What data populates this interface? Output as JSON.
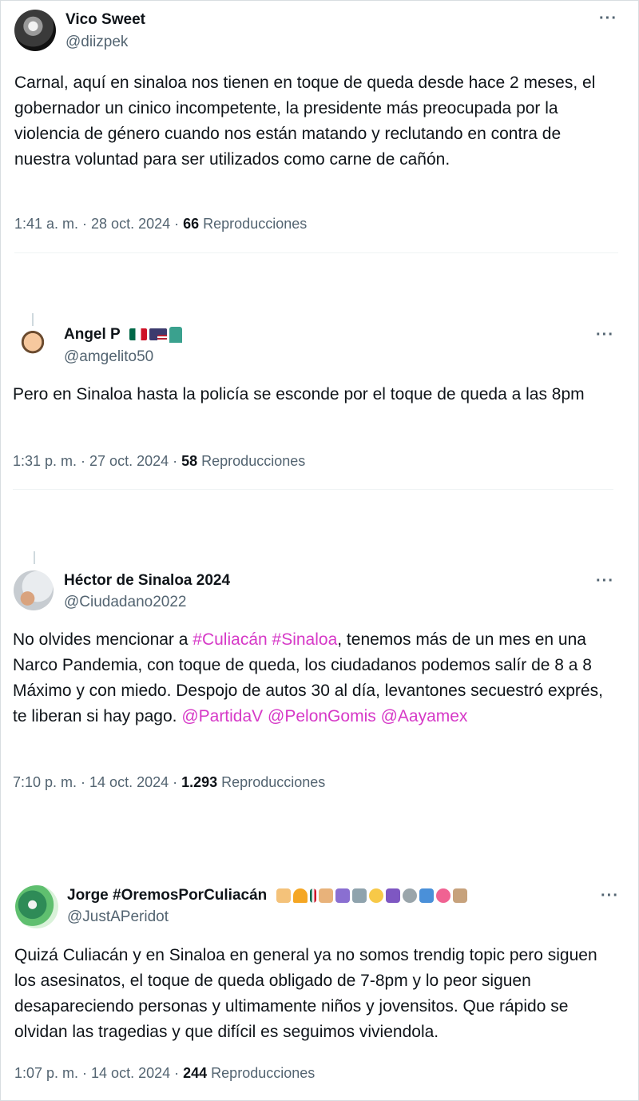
{
  "tweets": [
    {
      "name": "Vico Sweet",
      "handle": "@diizpek",
      "more": "···",
      "text": "Carnal, aquí en sinaloa nos tienen en toque de queda desde hace 2 meses, el gobernador un cinico incompetente, la presidente más preocupada por la violencia de género cuando nos están matando y reclutando en contra de nuestra voluntad para ser utilizados como carne de cañón.",
      "time": "1:41 a. m. · 28 oct. 2024 · ",
      "views_count": "66",
      "views_label": " Reproducciones"
    },
    {
      "name": "Angel P",
      "handle": "@amgelito50",
      "more": "···",
      "text": "Pero en Sinaloa hasta la policía se esconde por el toque de queda a las 8pm",
      "time": "1:31 p. m. · 27 oct. 2024 · ",
      "views_count": "58",
      "views_label": " Reproducciones"
    },
    {
      "name": "Héctor de Sinaloa 2024",
      "handle": "@Ciudadano2022",
      "more": "···",
      "text_parts": {
        "p1": "No olvides mencionar a ",
        "h1": "#Culiacán",
        "sp1": " ",
        "h2": "#Sinaloa",
        "p2": ", tenemos más de un mes en una Narco Pandemia, con toque de queda, los ciudadanos podemos salír de 8 a 8 Máximo y con miedo. Despojo de autos 30 al día, levantones secuestró exprés, te liberan si hay pago. ",
        "m1": "@PartidaV",
        "sp2": " ",
        "m2": "@PelonGomis",
        "sp3": " ",
        "m3": "@Aayamex"
      },
      "time": "7:10 p. m. · 14 oct. 2024 · ",
      "views_count": "1.293",
      "views_label": " Reproducciones"
    },
    {
      "name": "Jorge #OremosPorCuliacán",
      "handle": "@JustAPeridot",
      "more": "···",
      "text": "Quizá Culiacán y en Sinaloa en general ya no somos trendig topic pero siguen los asesinatos, el toque de queda obligado de 7-8pm y lo peor siguen desapareciendo personas y ultimamente niños y jovensitos. Que rápido se olvidan las tragedias y que difícil es seguimos viviendola.",
      "time": "1:07 p. m. · 14 oct. 2024 · ",
      "views_count": "244",
      "views_label": " Reproducciones"
    }
  ],
  "colors": {
    "link": "#d639c7",
    "secondary_text": "#536471",
    "primary_text": "#0f1419"
  },
  "icons": [
    "more-options-icon",
    "mexico-flag-icon",
    "us-flag-icon",
    "statue-of-liberty-icon"
  ]
}
